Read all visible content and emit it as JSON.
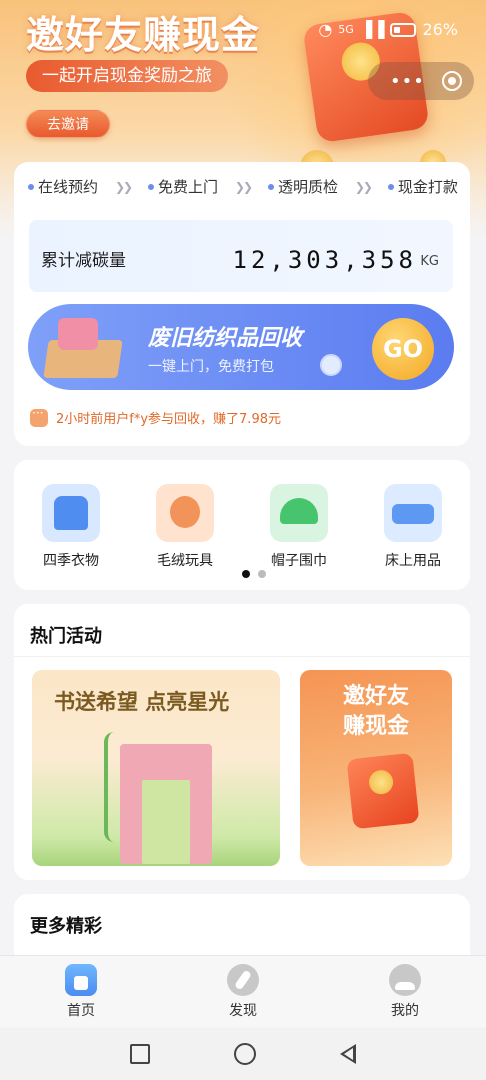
{
  "status_bar": {
    "signal_label": "5G",
    "battery": "26%"
  },
  "banner": {
    "title": "邀好友赚现金",
    "subtitle": "一起开启现金奖励之旅",
    "invite_button": "去邀请"
  },
  "service_steps": [
    "在线预约",
    "免费上门",
    "透明质检",
    "现金打款"
  ],
  "carbon": {
    "label": "累计减碳量",
    "value": "12,303,358",
    "unit": "KG"
  },
  "recycle": {
    "title": "废旧纺织品回收",
    "subtitle": "一键上门，免费打包",
    "go_label": "GO"
  },
  "notice": "2小时前用户f*y参与回收，赚了7.98元",
  "categories": [
    {
      "label": "四季衣物",
      "icon": "sweater-icon"
    },
    {
      "label": "毛绒玩具",
      "icon": "teddy-bear-icon"
    },
    {
      "label": "帽子围巾",
      "icon": "hat-icon"
    },
    {
      "label": "床上用品",
      "icon": "bedding-icon"
    }
  ],
  "carousel": {
    "pages": 2,
    "active": 1
  },
  "hot": {
    "title": "热门活动",
    "card1_title": "书送希望  点亮星光",
    "card2_title": "邀好友\n赚现金"
  },
  "more": {
    "title": "更多精彩"
  },
  "nav": [
    {
      "label": "首页",
      "icon": "home-icon",
      "active": true
    },
    {
      "label": "发现",
      "icon": "discover-icon",
      "active": false
    },
    {
      "label": "我的",
      "icon": "profile-icon",
      "active": false
    }
  ],
  "colors": {
    "accent_orange": "#e85a2e",
    "accent_blue": "#5b7cf0",
    "notice": "#e06a2a"
  }
}
